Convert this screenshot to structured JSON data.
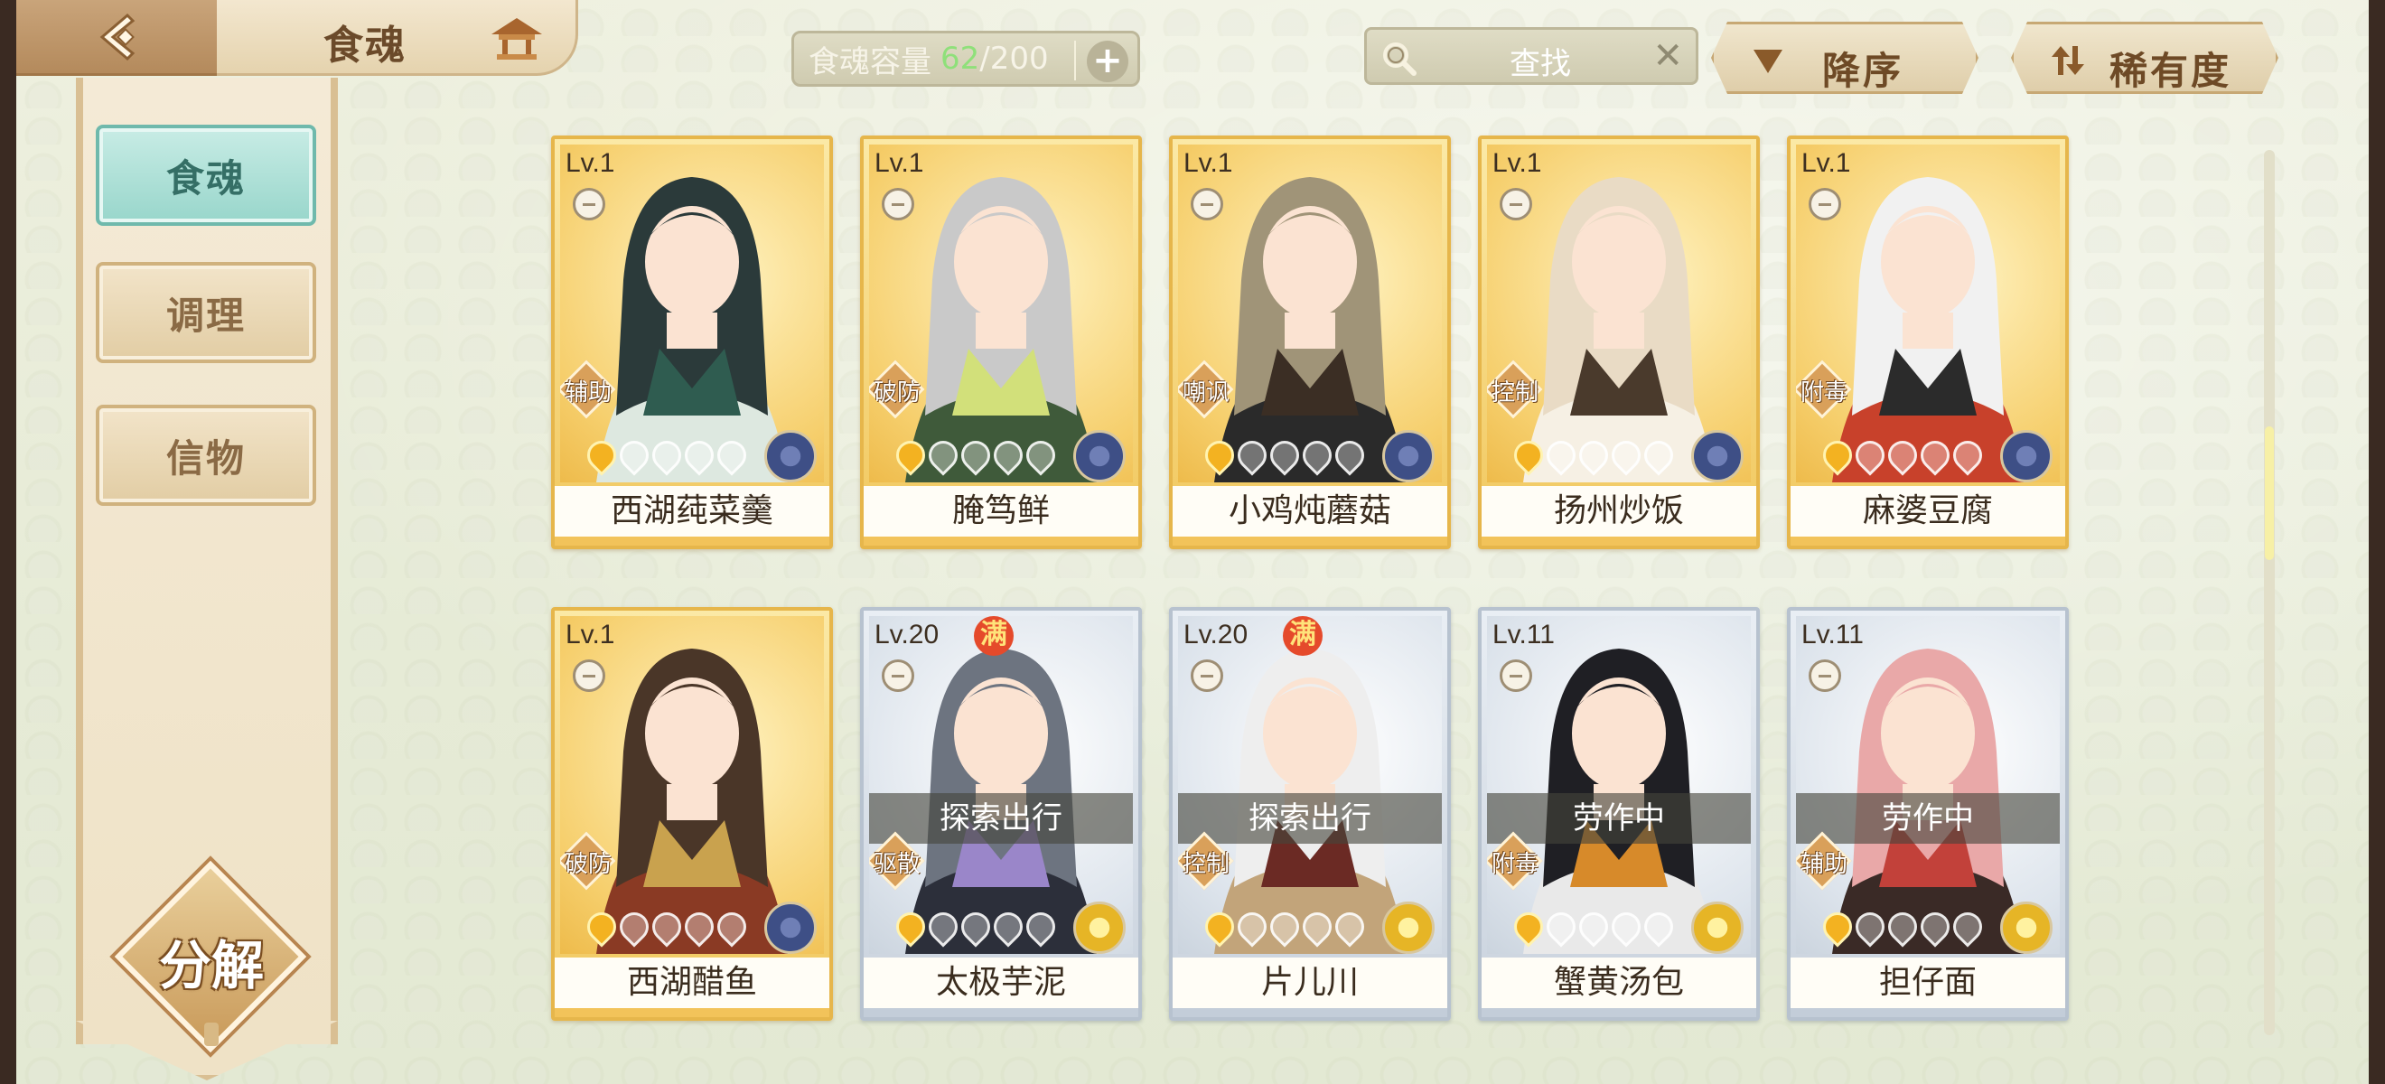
{
  "header": {
    "title": "食魂",
    "back_icon": "back-arrow-icon",
    "home_icon": "pavilion-icon"
  },
  "sidebar": {
    "tabs": [
      {
        "label": "食魂",
        "active": true
      },
      {
        "label": "调理",
        "active": false
      },
      {
        "label": "信物",
        "active": false
      }
    ],
    "decompose_label": "分解"
  },
  "toolbar": {
    "capacity_label": "食魂容量",
    "capacity_current": "62",
    "capacity_sep": "/",
    "capacity_max": "200",
    "capacity_plus": "+",
    "search_placeholder": "查找",
    "search_clear": "✕",
    "sort_label": "降序",
    "filter_label": "稀有度"
  },
  "cards": [
    {
      "level": "Lv.1",
      "name": "西湖莼菜羹",
      "role": "辅助",
      "rarity": "gold",
      "element": "blue",
      "full": false,
      "status": "",
      "stars_on": 1,
      "stars_total": 5
    },
    {
      "level": "Lv.1",
      "name": "腌笃鲜",
      "role": "破防",
      "rarity": "gold",
      "element": "blue",
      "full": false,
      "status": "",
      "stars_on": 1,
      "stars_total": 5
    },
    {
      "level": "Lv.1",
      "name": "小鸡炖蘑菇",
      "role": "嘲讽",
      "rarity": "gold",
      "element": "blue",
      "full": false,
      "status": "",
      "stars_on": 1,
      "stars_total": 5
    },
    {
      "level": "Lv.1",
      "name": "扬州炒饭",
      "role": "控制",
      "rarity": "gold",
      "element": "blue",
      "full": false,
      "status": "",
      "stars_on": 1,
      "stars_total": 5
    },
    {
      "level": "Lv.1",
      "name": "麻婆豆腐",
      "role": "附毒",
      "rarity": "gold",
      "element": "blue",
      "full": false,
      "status": "",
      "stars_on": 1,
      "stars_total": 5
    },
    {
      "level": "Lv.1",
      "name": "西湖醋鱼",
      "role": "破防",
      "rarity": "gold",
      "element": "blue",
      "full": false,
      "status": "",
      "stars_on": 1,
      "stars_total": 5
    },
    {
      "level": "Lv.20",
      "name": "太极芋泥",
      "role": "驱散",
      "rarity": "silver",
      "element": "yellow",
      "full": true,
      "full_label": "满",
      "status": "探索出行",
      "stars_on": 1,
      "stars_total": 5
    },
    {
      "level": "Lv.20",
      "name": "片儿川",
      "role": "控制",
      "rarity": "silver",
      "element": "yellow",
      "full": true,
      "full_label": "满",
      "status": "探索出行",
      "stars_on": 1,
      "stars_total": 5
    },
    {
      "level": "Lv.11",
      "name": "蟹黄汤包",
      "role": "附毒",
      "rarity": "silver",
      "element": "yellow",
      "full": false,
      "status": "劳作中",
      "stars_on": 1,
      "stars_total": 5
    },
    {
      "level": "Lv.11",
      "name": "担仔面",
      "role": "辅助",
      "rarity": "silver",
      "element": "yellow",
      "full": false,
      "status": "劳作中",
      "stars_on": 1,
      "stars_total": 5
    }
  ],
  "scroll_position": 0.3
}
